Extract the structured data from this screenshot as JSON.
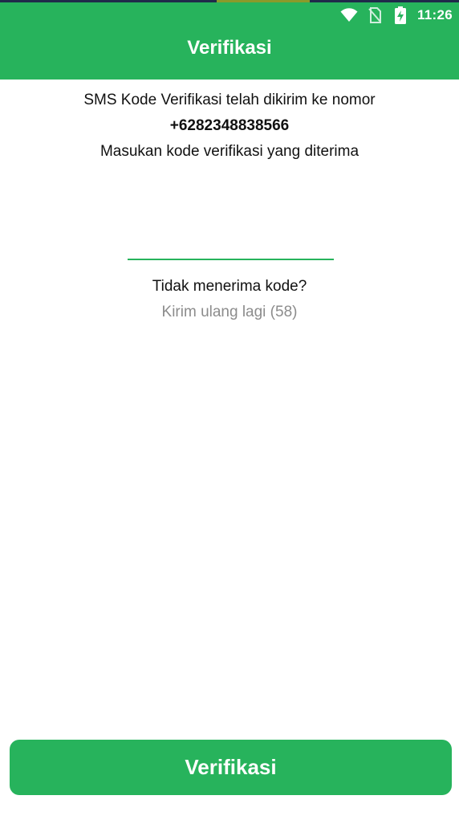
{
  "status_bar": {
    "time": "11:26",
    "icons": [
      "wifi-icon",
      "no-sim-icon",
      "battery-charging-icon"
    ]
  },
  "app_bar": {
    "title": "Verifikasi"
  },
  "info": {
    "line1": "SMS Kode Verifikasi telah dikirim ke nomor",
    "phone_number": "+6282348838566",
    "line3": "Masukan kode verifikasi yang diterima"
  },
  "code_input": {
    "value": "",
    "placeholder": ""
  },
  "resend": {
    "question": "Tidak menerima kode?",
    "link_label": "Kirim ulang lagi (58)"
  },
  "actions": {
    "verify_label": "Verifikasi"
  },
  "colors": {
    "primary": "#27b35c",
    "muted_text": "#8c8c8c",
    "text": "#111111"
  }
}
